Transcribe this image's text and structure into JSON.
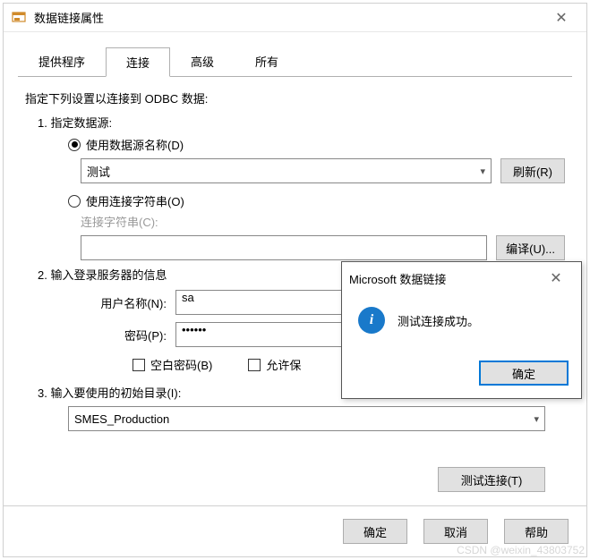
{
  "window": {
    "title": "数据链接属性",
    "close_glyph": "✕"
  },
  "tabs": {
    "provider": "提供程序",
    "connection": "连接",
    "advanced": "高级",
    "all": "所有"
  },
  "instructions": "指定下列设置以连接到 ODBC 数据:",
  "section1": {
    "heading": "1. 指定数据源:",
    "radio_dsn": "使用数据源名称(D)",
    "dsn_value": "测试",
    "refresh_btn": "刷新(R)",
    "radio_connstr": "使用连接字符串(O)",
    "connstr_label": "连接字符串(C):",
    "connstr_value": "",
    "build_btn": "编译(U)..."
  },
  "section2": {
    "heading": "2. 输入登录服务器的信息",
    "username_label": "用户名称(N):",
    "username_value": "sa",
    "password_label": "密码(P):",
    "password_value": "••••••",
    "blank_pwd": "空白密码(B)",
    "allow_save": "允许保"
  },
  "section3": {
    "heading": "3. 输入要使用的初始目录(I):",
    "catalog_value": "SMES_Production"
  },
  "test_connection_btn": "测试连接(T)",
  "footer": {
    "ok": "确定",
    "cancel": "取消",
    "help": "帮助"
  },
  "msgbox": {
    "title": "Microsoft 数据链接",
    "message": "测试连接成功。",
    "ok": "确定"
  },
  "watermark": "CSDN @weixin_43803752"
}
